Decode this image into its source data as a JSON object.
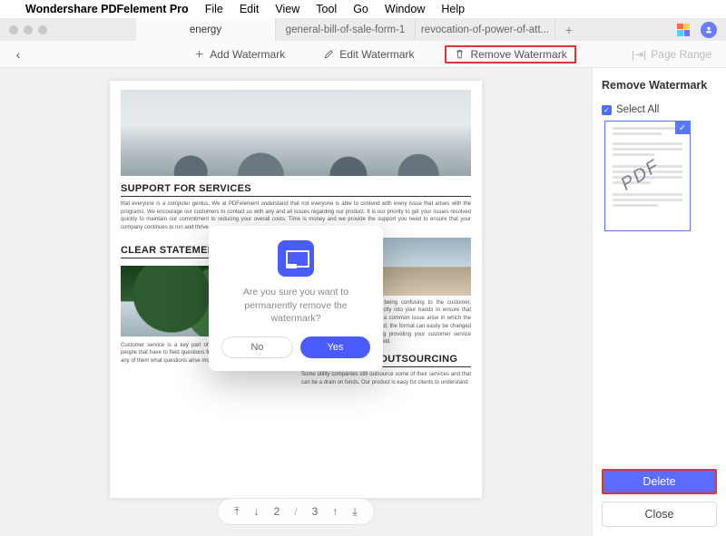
{
  "menubar": {
    "app": "Wondershare PDFelement Pro",
    "items": [
      "File",
      "Edit",
      "View",
      "Tool",
      "Go",
      "Window",
      "Help"
    ]
  },
  "tabs": {
    "list": [
      {
        "label": "energy",
        "active": true
      },
      {
        "label": "general-bill-of-sale-form-1",
        "active": false
      },
      {
        "label": "revocation-of-power-of-att...",
        "active": false
      }
    ]
  },
  "toolbar": {
    "add": "Add Watermark",
    "edit": "Edit Watermark",
    "remove": "Remove Watermark",
    "page_range": "Page Range"
  },
  "document": {
    "sec1_title": "SUPPORT FOR SERVICES",
    "sec1_body": "that everyone is a computer genius. We at PDFelement understand that not everyone is able to contend with every issue that arises with the programs. We encourage our customers to contact us with any and all issues regarding our product. It is our priority to get your issues resolved quickly to maintain our commitment to reducing your overall costs. Time is money and we provide the support you need to ensure that your company continues to run and thrive",
    "sec2_title": "CLEAR STATEMENTS",
    "sec2_bodyL": "Customer service is a key part of any utility company. It is these people that have to field questions from customers and when you ask any of them what questions arise most, it is",
    "sec2_bodyR": "often related to the statement being confusing to the customer. PDFelement puts the power directly into your hands to ensure that statements are clear and should a common issue arise in which the customers continue to be confused, the format can easily be changed to allow for better understanding providing your customer service representatives with few calls to field.",
    "sec3_title": "REDUCTION IN OUTSOURCING",
    "sec3_body": "Some utility companies still outsource some of their services and that can be a drain on funds. Our product is easy for clients to understand"
  },
  "pager": {
    "current": "2",
    "sep": "/",
    "total": "3"
  },
  "rpanel": {
    "title": "Remove Watermark",
    "select_all": "Select All",
    "watermark_text": "PDF",
    "delete": "Delete",
    "close": "Close"
  },
  "modal": {
    "text": "Are you sure you want to permanently remove the watermark?",
    "no": "No",
    "yes": "Yes"
  }
}
